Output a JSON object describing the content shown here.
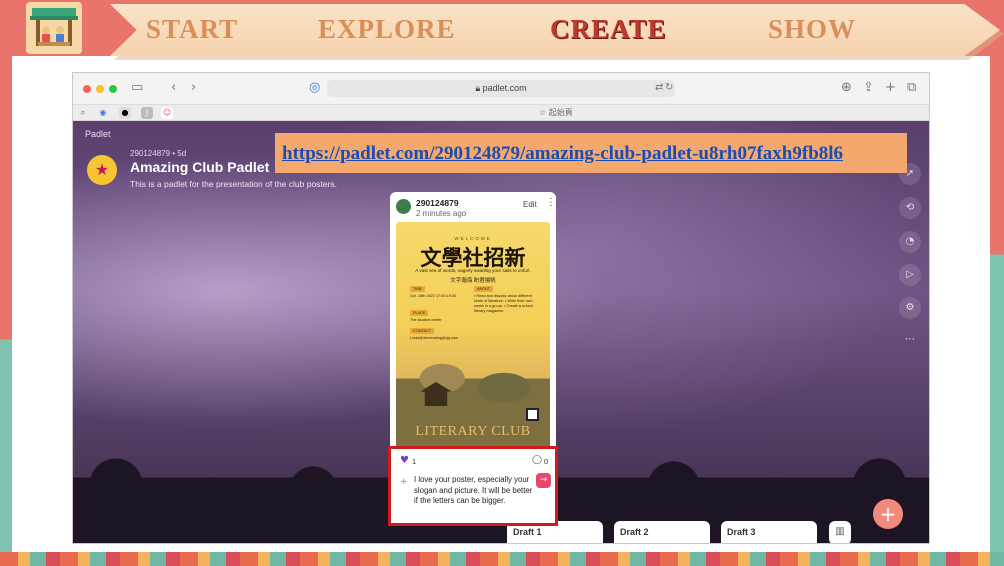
{
  "nav": {
    "steps": [
      "START",
      "EXPLORE",
      "CREATE",
      "SHOW"
    ],
    "active": "CREATE"
  },
  "browser": {
    "address": "padlet.com",
    "start_page_label": "起始頁"
  },
  "padlet": {
    "brand": "Padlet",
    "meta": "290124879 • 5d",
    "title": "Amazing Club Padlet",
    "description": "This is a padlet for the presentation of the club posters.",
    "url": "https://padlet.com/290124879/amazing-club-padlet-u8rh07faxh9fb8l6",
    "add_button": "+",
    "drafts": [
      "Draft 1",
      "Draft 2",
      "Draft 3"
    ]
  },
  "post": {
    "author": "290124879",
    "time": "2 minutes ago",
    "edit_label": "Edit",
    "more": "⋮",
    "poster": {
      "welcome": "WELCOME",
      "title": "文學社招新",
      "subtitle_en": "A vast sea of words, eagerly awaiting your sails to unfurl.",
      "subtitle_zh": "文字瀚海 盼君揚帆",
      "tag_time": "TIME",
      "time_text": "Oct. 15th 2022 17:00-19:00",
      "tag_activity": "ABOUT",
      "activity_text": "• Read and discuss about different kinds of literature. • Write their own works in a group. • Create a school literary magazine.",
      "tag_place": "PLACE",
      "place_text": "The student center",
      "tag_contact": "CONTACT",
      "contact_text": "Linda@abcreading@qq.com",
      "club": "LITERARY CLUB"
    },
    "likes": "1",
    "comments": "0",
    "comment_text": "I love your poster, especially your slogan and picture. It will be better if the letters can be bigger."
  },
  "colors": {
    "accent_red": "#c0392b",
    "nav_text": "#d99058",
    "link": "#1a4db3",
    "send_button": "#e8466e",
    "fab": "#ef8a7c"
  }
}
